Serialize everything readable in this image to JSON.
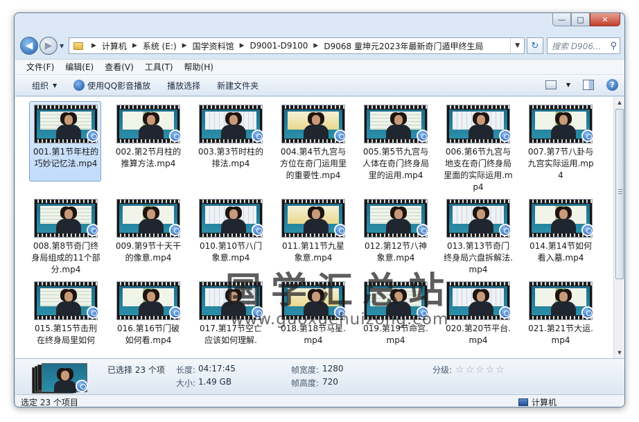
{
  "window": {
    "controls": {
      "minimize": "—",
      "maximize": "□",
      "close": "✕"
    }
  },
  "nav": {
    "back": "◀",
    "forward": "▶"
  },
  "address": {
    "crumbs": [
      "计算机",
      "系统 (E:)",
      "国学资料馆",
      "D9001-D9100",
      "D9068 童坤元2023年最新奇门遁甲终生局"
    ],
    "dropdown": "▼"
  },
  "refresh": "↻",
  "search": {
    "placeholder": "搜索 D906...",
    "icon": "⚲"
  },
  "menu": [
    "文件(F)",
    "编辑(E)",
    "查看(V)",
    "工具(T)",
    "帮助(H)"
  ],
  "toolbar": {
    "organize": "组织",
    "play_qq": "使用QQ影音播放",
    "play_selection": "播放选择",
    "new_folder": "新建文件夹",
    "help": "?"
  },
  "files": [
    "001.第1节年柱的巧妙记忆法.mp4",
    "002.第2节月柱的推算方法.mp4",
    "003.第3节时柱的排法.mp4",
    "004.第4节九宫与方位在奇门运用里的重要性.mp4",
    "005.第5节九宫与人体在奇门终身局里的运用.mp4",
    "006.第6节九宫与地支在奇门终身局里面的实际运用.mp4",
    "007.第7节八卦与九宫实际运用.mp4",
    "008.第8节奇门终身局组成的11个部分.mp4",
    "009.第9节十天干的像意.mp4",
    "010.第10节八门象意.mp4",
    "011.第11节九星象意.mp4",
    "012.第12节八神象意.mp4",
    "013.第13节奇门终身局六盘拆解法.mp4",
    "014.第14节如何看入墓.mp4",
    "015.第15节击刑在终身局里如何",
    "016.第16节门破如何看.mp4",
    "017.第17节空亡应该如何理解.",
    "018.第18节马星.mp4",
    "019.第19节命宫.mp4",
    "020.第20节平台.mp4",
    "021.第21节大运.mp4"
  ],
  "watermark": {
    "cn": "国学汇总站",
    "en": "www.guoxuehuizong.com"
  },
  "details": {
    "selected": "已选择 23 个项",
    "length_label": "长度:",
    "length": "04:17:45",
    "size_label": "大小:",
    "size": "1.49 GB",
    "width_label": "帧宽度:",
    "width": "1280",
    "height_label": "帧高度:",
    "height": "720",
    "rating_label": "分级:",
    "rating_stars": "☆☆☆☆☆",
    "rating": 0
  },
  "status": {
    "left": "选定 23 个项目",
    "right": "计算机"
  }
}
